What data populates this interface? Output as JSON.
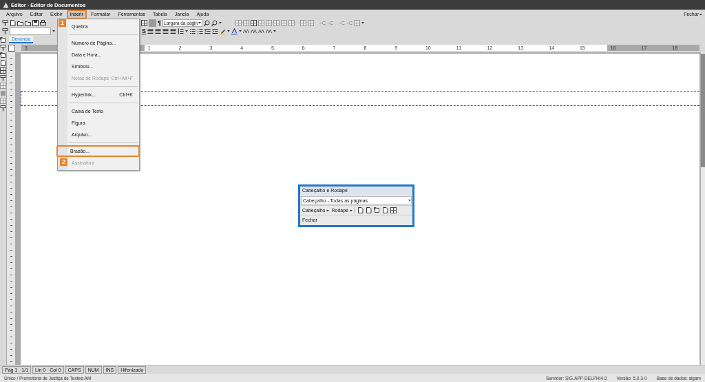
{
  "window": {
    "title": "Editor - Editor de Documentos"
  },
  "menubar": {
    "items": [
      {
        "label": "Arquivo",
        "selected": false
      },
      {
        "label": "Editar",
        "selected": false
      },
      {
        "label": "Exibir",
        "selected": false
      },
      {
        "label": "Inserir",
        "selected": true,
        "highlighted": true,
        "callout": "1"
      },
      {
        "label": "Formatar",
        "selected": false
      },
      {
        "label": "Ferramentas",
        "selected": false
      },
      {
        "label": "Tabela",
        "selected": false
      },
      {
        "label": "Janela",
        "selected": false
      },
      {
        "label": "Ajuda",
        "selected": false
      }
    ],
    "close": "Fechar"
  },
  "toolbar": {
    "zoom_value": "Largura da págin",
    "paragraph_mark": "¶",
    "underline_label": "S"
  },
  "tabs": [
    {
      "label": "Denúncia",
      "selected": true
    }
  ],
  "ruler": {
    "left_labels": [
      "3"
    ],
    "right_labels": [
      "1",
      "2",
      "3",
      "4",
      "5",
      "6",
      "7",
      "8",
      "9",
      "10",
      "11",
      "12",
      "13",
      "14",
      "15",
      "16",
      "17",
      "18"
    ]
  },
  "insert_menu": {
    "items": [
      {
        "kind": "item",
        "label": "Quebra",
        "disabled": false
      },
      {
        "kind": "separator"
      },
      {
        "kind": "item",
        "label": "Número de Página...",
        "disabled": false
      },
      {
        "kind": "item",
        "label": "Data e Hora...",
        "disabled": false
      },
      {
        "kind": "item",
        "label": "Símbolo...",
        "disabled": false
      },
      {
        "kind": "item",
        "label": "Notas de Rodapé",
        "shortcut": "Ctrl+Alt+F",
        "disabled": true
      },
      {
        "kind": "separator"
      },
      {
        "kind": "item",
        "label": "Hyperlink...",
        "shortcut": "Ctrl+K",
        "disabled": false
      },
      {
        "kind": "separator"
      },
      {
        "kind": "item",
        "label": "Caixa de Texto",
        "disabled": false
      },
      {
        "kind": "item",
        "label": "Figura",
        "disabled": false
      },
      {
        "kind": "item",
        "label": "Arquivo...",
        "disabled": false
      },
      {
        "kind": "separator"
      },
      {
        "kind": "item",
        "label": "Brasão...",
        "disabled": false,
        "highlighted": true
      },
      {
        "kind": "item",
        "label": "Assinatura",
        "disabled": true,
        "callout": "2"
      }
    ]
  },
  "header_footer_panel": {
    "title": "Cabeçalho e Rodapé",
    "selector": "Cabeçalho -  Todas as páginas",
    "buttons": [
      {
        "label": "Cabeçalho"
      },
      {
        "label": "Rodapé"
      }
    ],
    "close": "Fechar"
  },
  "status_bar": {
    "groups": [
      {
        "items": [
          "Pág 1",
          "1/1"
        ]
      },
      {
        "items": [
          "Lin 0",
          "Col 0"
        ]
      },
      {
        "items": [
          "CAPS"
        ]
      },
      {
        "items": [
          "NUM"
        ]
      },
      {
        "items": [
          "INS"
        ]
      },
      {
        "items": [
          "Hifenizado"
        ]
      }
    ]
  },
  "footer": {
    "location": "Único / Promotoria de Justiça de Textes-AM",
    "server": "Servidor: SIG.APP-DELPHI4.0",
    "version": "Versão: 5.0.3-0",
    "database": "Base de dados: sigam"
  }
}
